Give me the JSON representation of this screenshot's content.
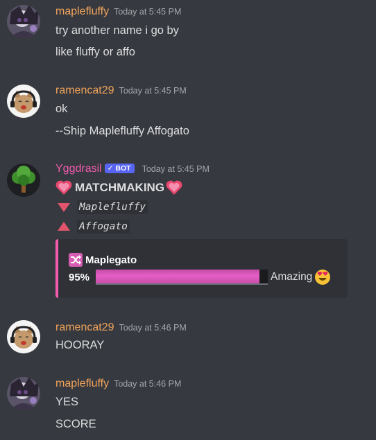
{
  "messages": [
    {
      "user": "maplefluffy",
      "timestamp": "Today at 5:45 PM",
      "lines": [
        "try another name i go by",
        "like fluffy or affo"
      ]
    },
    {
      "user": "ramencat29",
      "timestamp": "Today at 5:45 PM",
      "lines": [
        "ok",
        "--Ship Maplefluffy Affogato"
      ]
    },
    {
      "user": "Yggdrasil",
      "bot_tag": "BOT",
      "timestamp": "Today at 5:45 PM",
      "title": "MATCHMAKING",
      "name_down": "Maplefluffy",
      "name_up": "Affogato",
      "embed": {
        "ship_name": "Maplegato",
        "percent": "95%",
        "percent_value": 95,
        "rating": "Amazing"
      }
    },
    {
      "user": "ramencat29",
      "timestamp": "Today at 5:46 PM",
      "lines": [
        "HOORAY"
      ]
    },
    {
      "user": "maplefluffy",
      "timestamp": "Today at 5:46 PM",
      "lines": [
        "YES",
        "SCORE"
      ]
    }
  ],
  "colors": {
    "background": "#36393f",
    "username_orange": "#f0a35b",
    "bot_username_pink": "#f15cae",
    "bot_tag": "#5865f2",
    "embed_border": "#f15cae",
    "progress_fill": "#e05cc4"
  },
  "icons": {
    "heart": "sparkling-heart-icon",
    "down": "red-triangle-down-icon",
    "up": "red-triangle-up-icon",
    "ship": "shuffle-icon",
    "rating": "heart-eyes-emoji-icon"
  }
}
